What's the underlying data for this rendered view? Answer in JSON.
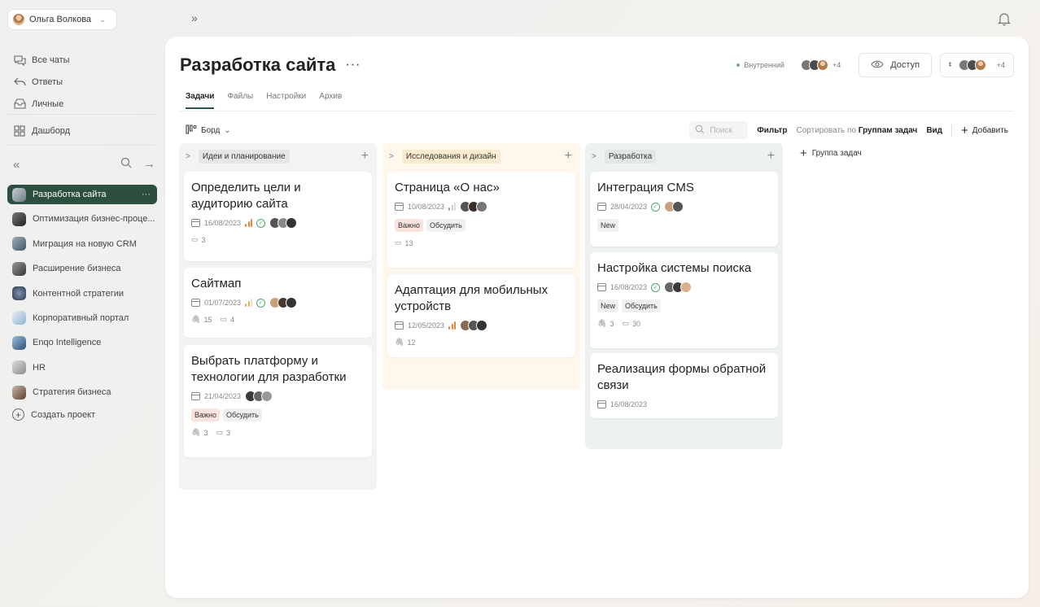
{
  "user": {
    "name": "Ольга Волкова"
  },
  "topbar": {
    "expand_glyph": "»"
  },
  "sidebar": {
    "nav": [
      {
        "label": "Все чаты",
        "icon": "chat-icon"
      },
      {
        "label": "Ответы",
        "icon": "reply-icon"
      },
      {
        "label": "Личные",
        "icon": "inbox-icon"
      }
    ],
    "dashboard": {
      "label": "Дашборд",
      "icon": "dashboard-icon"
    },
    "tools": {
      "collapse": "«",
      "search": "search-icon",
      "forward": "→"
    },
    "projects": [
      {
        "label": "Разработка сайта",
        "active": true,
        "color": "#6d7a84"
      },
      {
        "label": "Оптимизация бизнес-проце...",
        "active": false,
        "color": "#3b3b3b"
      },
      {
        "label": "Миграция на новую CRM",
        "active": false,
        "color": "#5b6e7c"
      },
      {
        "label": "Расширение бизнеса",
        "active": false,
        "color": "#4a4a4a"
      },
      {
        "label": "Контентной стратегии",
        "active": false,
        "color": "#3d4d63"
      },
      {
        "label": "Корпоративный портал",
        "active": false,
        "color": "#8fb4d4"
      },
      {
        "label": "Enqo Intelligence",
        "active": false,
        "color": "#3a5a7a"
      },
      {
        "label": "HR",
        "active": false,
        "color": "#a9a9a9"
      },
      {
        "label": "Стратегия бизнеса",
        "active": false,
        "color": "#6a5140"
      }
    ],
    "create_label": "Создать проект"
  },
  "project": {
    "title": "Разработка сайта",
    "more": "···",
    "visibility": "Внутренний",
    "members_extra": "+4",
    "access_label": "Доступ",
    "team_extra": "+4"
  },
  "tabs": [
    "Задачи",
    "Файлы",
    "Настройки",
    "Архив"
  ],
  "toolbar": {
    "view_label": "Борд",
    "search_placeholder": "Поиск",
    "filter_label": "Фильтр",
    "sort_prefix": "Сортировать по",
    "sort_value": "Группам задач",
    "view_menu": "Вид",
    "add_label": "Добавить"
  },
  "add_group_label": "Группа задач",
  "columns": [
    {
      "name": "Идеи и планирование",
      "label_bg": "#eeeeee",
      "col_bg": "#f3f3f3",
      "cards": [
        {
          "title": "Определить цели и аудиторию сайта",
          "date": "16/08/2023",
          "priority": "high",
          "done": true,
          "tags": [],
          "attachments": "",
          "comments": "3"
        },
        {
          "title": "Сайтмап",
          "date": "01/07/2023",
          "priority": "medium",
          "done": true,
          "tags": [],
          "attachments": "15",
          "comments": "4"
        },
        {
          "title": "Выбрать платформу и технологии для разработки",
          "date": "21/04/2023",
          "priority": "",
          "done": false,
          "tags": [
            "Важно",
            "Обсудить"
          ],
          "attachments": "3",
          "comments": "3"
        }
      ]
    },
    {
      "name": "Исследования и дизайн",
      "label_bg": "#fdf0d6",
      "col_bg": "#fdf7ec",
      "cards": [
        {
          "title": "Страница «О нас»",
          "date": "10/08/2023",
          "priority": "low",
          "done": false,
          "tags": [
            "Важно",
            "Обсудить"
          ],
          "attachments": "",
          "comments": "13"
        },
        {
          "title": "Адаптация для мобильных устройств",
          "date": "12/05/2023",
          "priority": "high",
          "done": false,
          "tags": [],
          "attachments": "12",
          "comments": ""
        }
      ]
    },
    {
      "name": "Разработка",
      "label_bg": "#e8ede9",
      "col_bg": "#eef2ef",
      "cards": [
        {
          "title": "Интеграция CMS",
          "date": "28/04/2023",
          "priority": "",
          "done": true,
          "tags": [
            "New"
          ],
          "attachments": "",
          "comments": ""
        },
        {
          "title": "Настройка системы поиска",
          "date": "16/08/2023",
          "priority": "",
          "done": true,
          "tags": [
            "New",
            "Обсудить"
          ],
          "attachments": "3",
          "comments": "30"
        },
        {
          "title": "Реализация формы обратной связи",
          "date": "16/08/2023",
          "priority": "",
          "done": false,
          "tags": [],
          "attachments": "",
          "comments": ""
        }
      ]
    }
  ]
}
